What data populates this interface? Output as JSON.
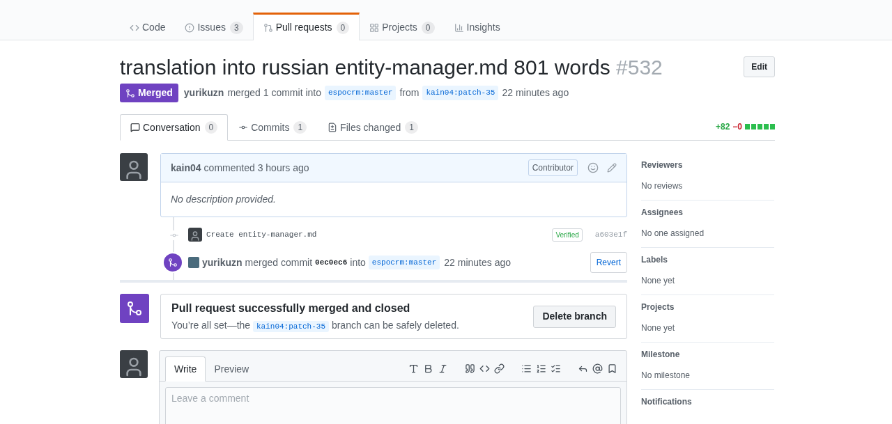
{
  "repo_tabs": [
    {
      "kind": "code",
      "label": "Code",
      "selected": false
    },
    {
      "kind": "issues",
      "label": "Issues",
      "count": "3",
      "selected": false
    },
    {
      "kind": "pulls",
      "label": "Pull requests",
      "count": "0",
      "selected": true
    },
    {
      "kind": "projects",
      "label": "Projects",
      "count": "0",
      "selected": false
    },
    {
      "kind": "insights",
      "label": "Insights",
      "selected": false
    }
  ],
  "pr": {
    "title": "translation into russian entity-manager.md 801 words",
    "number": "#532",
    "edit_button": "Edit",
    "state": "Merged",
    "author": "yurikuzn",
    "action": "merged 1 commit into",
    "base_branch": "espocrm:master",
    "from": "from",
    "head_branch": "kain04:patch-35",
    "time": "22 minutes ago"
  },
  "pr_tabs": [
    {
      "kind": "conversation",
      "label": "Conversation",
      "count": "0",
      "selected": true
    },
    {
      "kind": "commits",
      "label": "Commits",
      "count": "1",
      "selected": false
    },
    {
      "kind": "files",
      "label": "Files changed",
      "count": "1",
      "selected": false
    }
  ],
  "diffstat": {
    "added": "+82",
    "removed": "−0"
  },
  "comment": {
    "author": "kain04",
    "action": "commented 3 hours ago",
    "badge": "Contributor",
    "body": "No description provided."
  },
  "commit": {
    "message": "Create entity-manager.md",
    "verified": "Verified",
    "sha": "a603e1f"
  },
  "merge_event": {
    "actor": "yurikuzn",
    "action": "merged commit",
    "sha": "0ec0ec6",
    "into": "into",
    "branch": "espocrm:master",
    "time": "22 minutes ago",
    "button": "Revert"
  },
  "merged_box": {
    "title": "Pull request successfully merged and closed",
    "text_before": "You’re all set—the",
    "branch": "kain04:patch-35",
    "text_after": "branch can be safely deleted.",
    "button": "Delete branch"
  },
  "comment_form": {
    "tabs": [
      {
        "label": "Write",
        "selected": true
      },
      {
        "label": "Preview",
        "selected": false
      }
    ],
    "placeholder": "Leave a comment"
  },
  "sidebar": [
    {
      "heading": "Reviewers",
      "value": "No reviews"
    },
    {
      "heading": "Assignees",
      "value": "No one assigned"
    },
    {
      "heading": "Labels",
      "value": "None yet"
    },
    {
      "heading": "Projects",
      "value": "None yet"
    },
    {
      "heading": "Milestone",
      "value": "No milestone"
    },
    {
      "heading": "Notifications"
    }
  ]
}
